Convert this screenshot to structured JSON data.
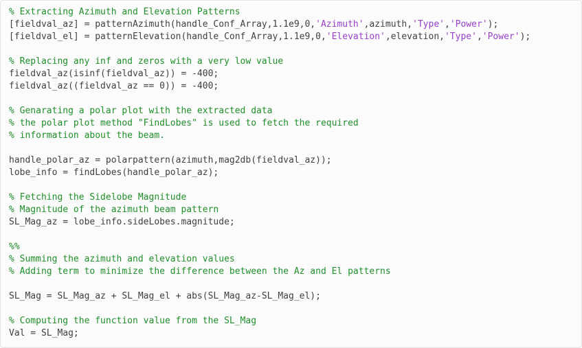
{
  "code": {
    "lines": [
      {
        "segs": [
          {
            "c": "cm",
            "t": "% Extracting Azimuth and Elevation Patterns"
          }
        ]
      },
      {
        "segs": [
          {
            "c": "",
            "t": "[fieldval_az] = patternAzimuth(handle_Conf_Array,1.1e9,0,"
          },
          {
            "c": "st",
            "t": "'Azimuth'"
          },
          {
            "c": "",
            "t": ",azimuth,"
          },
          {
            "c": "st",
            "t": "'Type'"
          },
          {
            "c": "",
            "t": ","
          },
          {
            "c": "st",
            "t": "'Power'"
          },
          {
            "c": "",
            "t": ");"
          }
        ]
      },
      {
        "segs": [
          {
            "c": "",
            "t": "[fieldval_el] = patternElevation(handle_Conf_Array,1.1e9,0,"
          },
          {
            "c": "st",
            "t": "'Elevation'"
          },
          {
            "c": "",
            "t": ",elevation,"
          },
          {
            "c": "st",
            "t": "'Type'"
          },
          {
            "c": "",
            "t": ","
          },
          {
            "c": "st",
            "t": "'Power'"
          },
          {
            "c": "",
            "t": ");"
          }
        ]
      },
      {
        "segs": [
          {
            "c": "",
            "t": ""
          }
        ]
      },
      {
        "segs": [
          {
            "c": "cm",
            "t": "% Replacing any inf and zeros with a very low value"
          }
        ]
      },
      {
        "segs": [
          {
            "c": "",
            "t": "fieldval_az(isinf(fieldval_az)) = -400;"
          }
        ]
      },
      {
        "segs": [
          {
            "c": "",
            "t": "fieldval_az((fieldval_az == 0)) = -400;"
          }
        ]
      },
      {
        "segs": [
          {
            "c": "",
            "t": ""
          }
        ]
      },
      {
        "segs": [
          {
            "c": "cm",
            "t": "% Genarating a polar plot with the extracted data"
          }
        ]
      },
      {
        "segs": [
          {
            "c": "cm",
            "t": "% the polar plot method \"FindLobes\" is used to fetch the required"
          }
        ]
      },
      {
        "segs": [
          {
            "c": "cm",
            "t": "% information about the beam."
          }
        ]
      },
      {
        "segs": [
          {
            "c": "",
            "t": ""
          }
        ]
      },
      {
        "segs": [
          {
            "c": "",
            "t": "handle_polar_az = polarpattern(azimuth,mag2db(fieldval_az));"
          }
        ]
      },
      {
        "segs": [
          {
            "c": "",
            "t": "lobe_info = findLobes(handle_polar_az);"
          }
        ]
      },
      {
        "segs": [
          {
            "c": "",
            "t": ""
          }
        ]
      },
      {
        "segs": [
          {
            "c": "cm",
            "t": "% Fetching the Sidelobe Magnitude"
          }
        ]
      },
      {
        "segs": [
          {
            "c": "cm",
            "t": "% Magnitude of the azimuth beam pattern"
          }
        ]
      },
      {
        "segs": [
          {
            "c": "",
            "t": "SL_Mag_az = lobe_info.sideLobes.magnitude;"
          }
        ]
      },
      {
        "segs": [
          {
            "c": "",
            "t": ""
          }
        ]
      },
      {
        "segs": [
          {
            "c": "cm",
            "t": "%%"
          }
        ]
      },
      {
        "segs": [
          {
            "c": "cm",
            "t": "% Summing the azimuth and elevation values"
          }
        ]
      },
      {
        "segs": [
          {
            "c": "cm",
            "t": "% Adding term to minimize the difference between the Az and El patterns"
          }
        ]
      },
      {
        "segs": [
          {
            "c": "",
            "t": ""
          }
        ]
      },
      {
        "segs": [
          {
            "c": "",
            "t": "SL_Mag = SL_Mag_az + SL_Mag_el + abs(SL_Mag_az-SL_Mag_el);"
          }
        ]
      },
      {
        "segs": [
          {
            "c": "",
            "t": ""
          }
        ]
      },
      {
        "segs": [
          {
            "c": "cm",
            "t": "% Computing the function value from the SL_Mag"
          }
        ]
      },
      {
        "segs": [
          {
            "c": "",
            "t": "Val = SL_Mag;"
          }
        ]
      }
    ]
  }
}
